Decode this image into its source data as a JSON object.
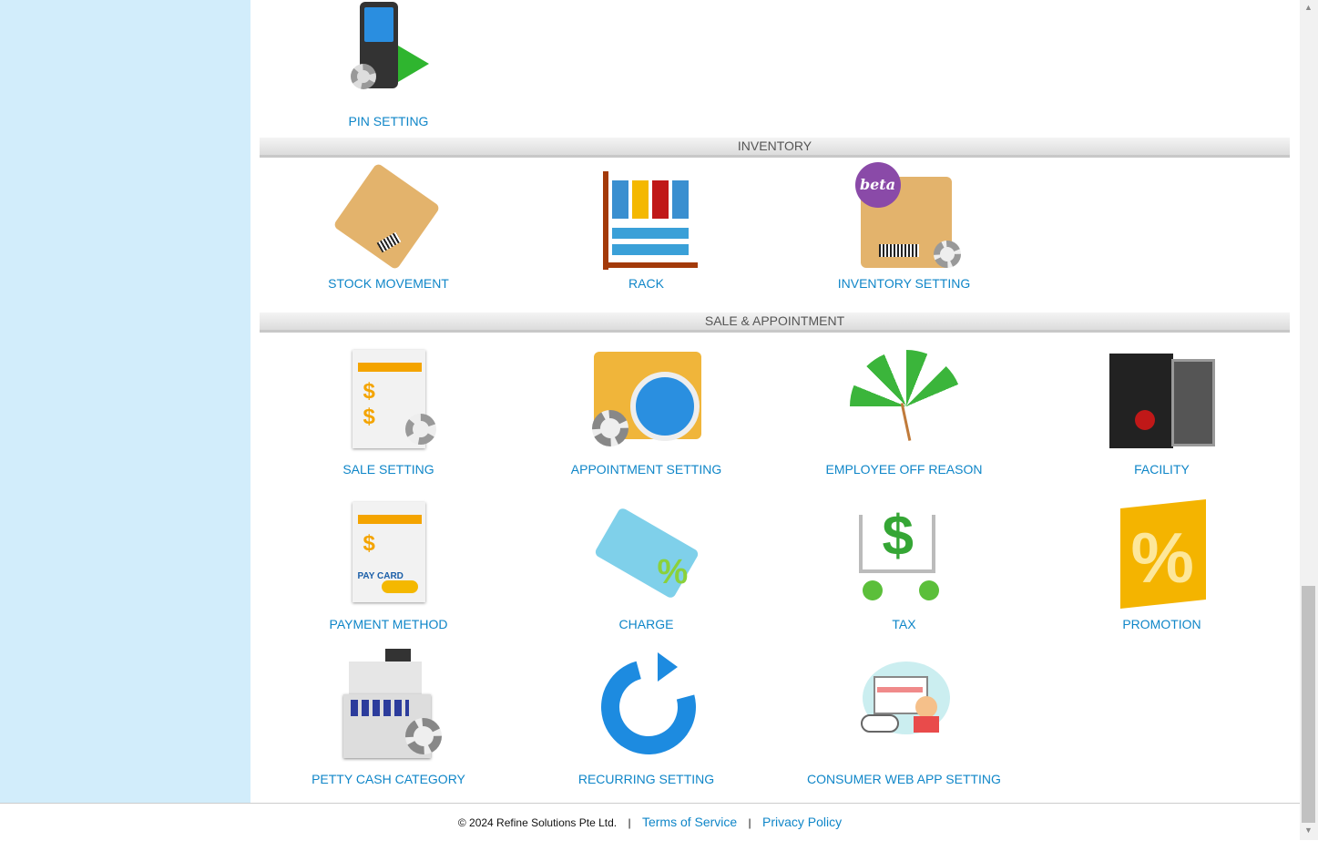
{
  "sections": {
    "inventory": "INVENTORY",
    "sale": "SALE & APPOINTMENT"
  },
  "tiles": {
    "pin_setting": "PIN SETTING",
    "stock_movement": "STOCK MOVEMENT",
    "rack": "RACK",
    "inventory_setting": "INVENTORY SETTING",
    "sale_setting": "SALE SETTING",
    "appointment_setting": "APPOINTMENT SETTING",
    "employee_off_reason": "EMPLOYEE OFF REASON",
    "facility": "FACILITY",
    "payment_method": "PAYMENT METHOD",
    "charge": "CHARGE",
    "tax": "TAX",
    "promotion": "PROMOTION",
    "petty_cash_category": "PETTY CASH CATEGORY",
    "recurring_setting": "RECURRING SETTING",
    "consumer_web_app_setting": "CONSUMER WEB APP SETTING"
  },
  "icon_text": {
    "beta": "beta",
    "pay_card": "PAY CARD"
  },
  "footer": {
    "copyright": "© 2024 Refine Solutions Pte Ltd.",
    "separator": "|",
    "terms": "Terms of Service",
    "privacy": "Privacy Policy"
  },
  "colors": {
    "link": "#0f86c8",
    "sidebar": "#d2edfb"
  }
}
